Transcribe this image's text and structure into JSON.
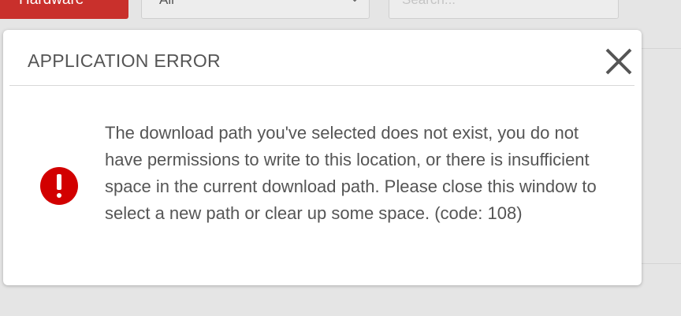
{
  "background": {
    "category_button_label": "Hardware",
    "filter_select_value": "All",
    "search_placeholder": "Search..."
  },
  "dialog": {
    "title": "APPLICATION ERROR",
    "message": "The download path you've selected does not exist, you do not have permissions to write to this location, or there is insufficient space in the current download path. Please close this window to select a new path or clear up some space. (code: 108)",
    "icon": "error-exclamation-icon",
    "close_icon": "close-icon"
  },
  "colors": {
    "error_red": "#d20000",
    "button_red": "#c9302c",
    "text_gray": "#555555"
  }
}
